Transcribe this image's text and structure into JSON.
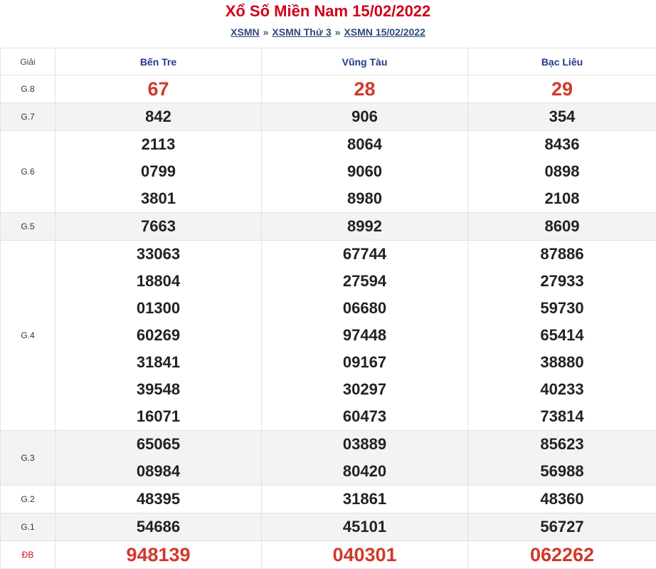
{
  "header": {
    "title": "Xổ Số Miền Nam 15/02/2022",
    "breadcrumb": {
      "item1": "XSMN",
      "item2": "XSMN Thứ 3",
      "item3": "XSMN 15/02/2022",
      "separator": "»"
    }
  },
  "table": {
    "prize_header": "Giải",
    "provinces": [
      "Bến Tre",
      "Vũng Tàu",
      "Bạc Liêu"
    ],
    "rows": [
      {
        "prize": "G.8",
        "results": [
          [
            "67"
          ],
          [
            "28"
          ],
          [
            "29"
          ]
        ]
      },
      {
        "prize": "G.7",
        "results": [
          [
            "842"
          ],
          [
            "906"
          ],
          [
            "354"
          ]
        ]
      },
      {
        "prize": "G.6",
        "results": [
          [
            "2113",
            "0799",
            "3801"
          ],
          [
            "8064",
            "9060",
            "8980"
          ],
          [
            "8436",
            "0898",
            "2108"
          ]
        ]
      },
      {
        "prize": "G.5",
        "results": [
          [
            "7663"
          ],
          [
            "8992"
          ],
          [
            "8609"
          ]
        ]
      },
      {
        "prize": "G.4",
        "results": [
          [
            "33063",
            "18804",
            "01300",
            "60269",
            "31841",
            "39548",
            "16071"
          ],
          [
            "67744",
            "27594",
            "06680",
            "97448",
            "09167",
            "30297",
            "60473"
          ],
          [
            "87886",
            "27933",
            "59730",
            "65414",
            "38880",
            "40233",
            "73814"
          ]
        ]
      },
      {
        "prize": "G.3",
        "results": [
          [
            "65065",
            "08984"
          ],
          [
            "03889",
            "80420"
          ],
          [
            "85623",
            "56988"
          ]
        ]
      },
      {
        "prize": "G.2",
        "results": [
          [
            "48395"
          ],
          [
            "31861"
          ],
          [
            "48360"
          ]
        ]
      },
      {
        "prize": "G.1",
        "results": [
          [
            "54686"
          ],
          [
            "45101"
          ],
          [
            "56727"
          ]
        ]
      },
      {
        "prize": "ĐB",
        "results": [
          [
            "948139"
          ],
          [
            "040301"
          ],
          [
            "062262"
          ]
        ]
      }
    ]
  },
  "colors": {
    "title": "#d0021b",
    "province": "#1f3a8a",
    "highlight_number": "#d0392b",
    "number": "#222222",
    "alt_row_bg": "#f3f3f3",
    "link": "#2c4a7a"
  }
}
